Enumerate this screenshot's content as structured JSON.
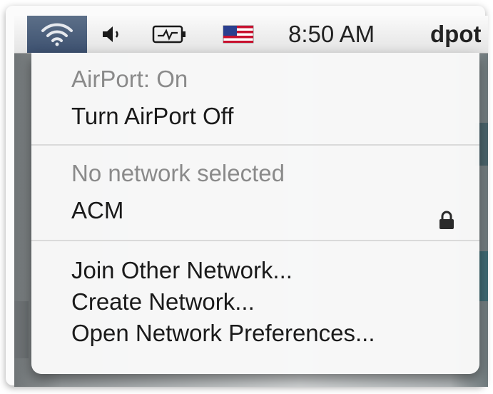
{
  "menubar": {
    "wifi_icon": "wifi-icon",
    "volume_icon": "speaker-icon",
    "battery_icon": "battery-charging-icon",
    "flag_icon": "us-flag-icon",
    "time": "8:50 AM",
    "user": "dpot"
  },
  "airport_menu": {
    "status": "AirPort: On",
    "toggle_label": "Turn AirPort Off",
    "network_status": "No network selected",
    "networks": [
      {
        "name": "ACM",
        "secured": true,
        "icon": "lock-icon"
      }
    ],
    "actions": [
      "Join Other Network...",
      "Create Network...",
      "Open Network Preferences..."
    ]
  },
  "colors": {
    "menubar_highlight": "#3d5170",
    "menu_background": "#f8f8f8",
    "disabled_text": "#8a8a8a"
  }
}
